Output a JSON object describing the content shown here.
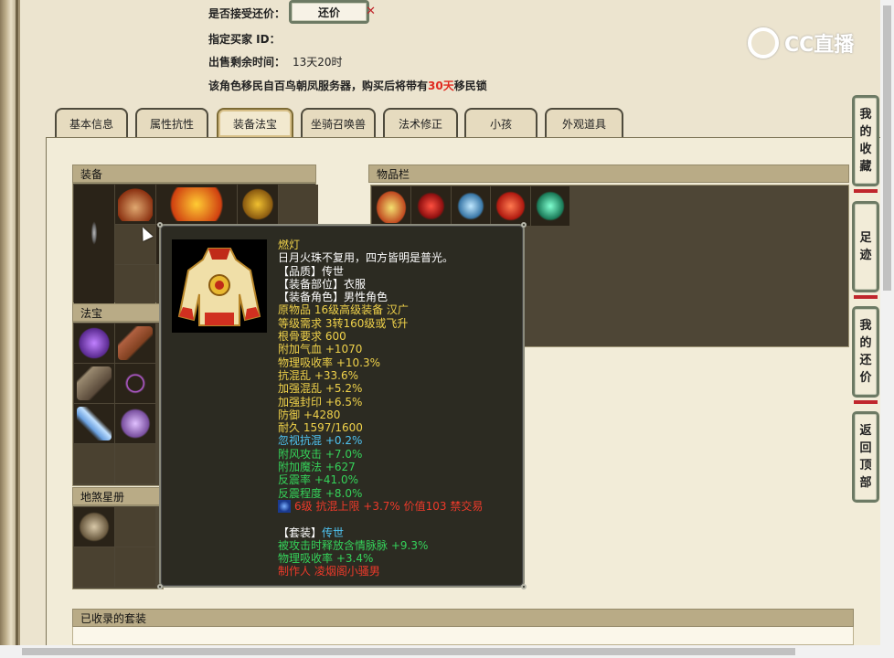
{
  "sale_info": {
    "accept_counter_label": "是否接受还价：",
    "counter_button": "还价",
    "buyer_label": "指定买家 ID：",
    "remaining_label": "出售剩余时间：",
    "remaining_value": "13天20时",
    "migration_prefix": "该角色移民自百鸟朝凤服务器，购买后将带有",
    "migration_days": "30天",
    "migration_suffix": "移民锁"
  },
  "watermark": "CC直播",
  "tabs": [
    {
      "label": "基本信息",
      "active": false
    },
    {
      "label": "属性抗性",
      "active": false
    },
    {
      "label": "装备法宝",
      "active": true
    },
    {
      "label": "坐骑召唤兽",
      "active": false
    },
    {
      "label": "法术修正",
      "active": false
    },
    {
      "label": "小孩",
      "active": false
    },
    {
      "label": "外观道具",
      "active": false
    }
  ],
  "sections": {
    "equipment": "装备",
    "treasure": "法宝",
    "star_book": "地煞星册",
    "inventory": "物品栏",
    "collected_sets": "已收录的套装"
  },
  "tooltip": {
    "name": "燃灯",
    "description": "日月火珠不复用，四方皆明是普光。",
    "quality": "【品质】传世",
    "slot": "【装备部位】衣服",
    "role": "【装备角色】男性角色",
    "original": "原物品 16级高级装备 汉广",
    "level_req": "等级需求 3转160级或飞升",
    "bone_req": "根骨要求 600",
    "stats_yellow": [
      "附加气血 +1070",
      "物理吸收率 +10.3%",
      "抗混乱 +33.6%",
      "加强混乱 +5.2%",
      "加强封印 +6.5%",
      "防御 +4280",
      "耐久 1597/1600"
    ],
    "stats_blue": [
      "忽视抗混 +0.2%"
    ],
    "stats_green": [
      "附风攻击 +7.0%",
      "附加魔法 +627",
      "反震率 +41.0%",
      "反震程度 +8.0%"
    ],
    "gem_line": "6级 抗混上限 +3.7% 价值103 禁交易",
    "set_label": "【套装】",
    "set_name": "传世",
    "set_effects": [
      "被攻击时释放含情脉脉 +9.3%",
      "物理吸收率 +3.4%"
    ],
    "maker": "制作人 凌烟阁小骚男"
  },
  "side_buttons": [
    {
      "label": "我的收藏",
      "chars": [
        "我",
        "的",
        "收",
        "藏"
      ]
    },
    {
      "label": "足迹",
      "chars": [
        "足",
        "迹"
      ]
    },
    {
      "label": "我的还价",
      "chars": [
        "我",
        "的",
        "还",
        "价"
      ]
    },
    {
      "label": "返回顶部",
      "chars": [
        "返",
        "回",
        "顶",
        "部"
      ]
    }
  ],
  "colors": {
    "panel_bg": "#f2ecd8",
    "accent_red": "#e02a20",
    "tooltip_bg": "#2c2b22",
    "stat_yellow": "#f0d24a",
    "stat_blue": "#4fc4f2",
    "stat_green": "#35d25a"
  }
}
